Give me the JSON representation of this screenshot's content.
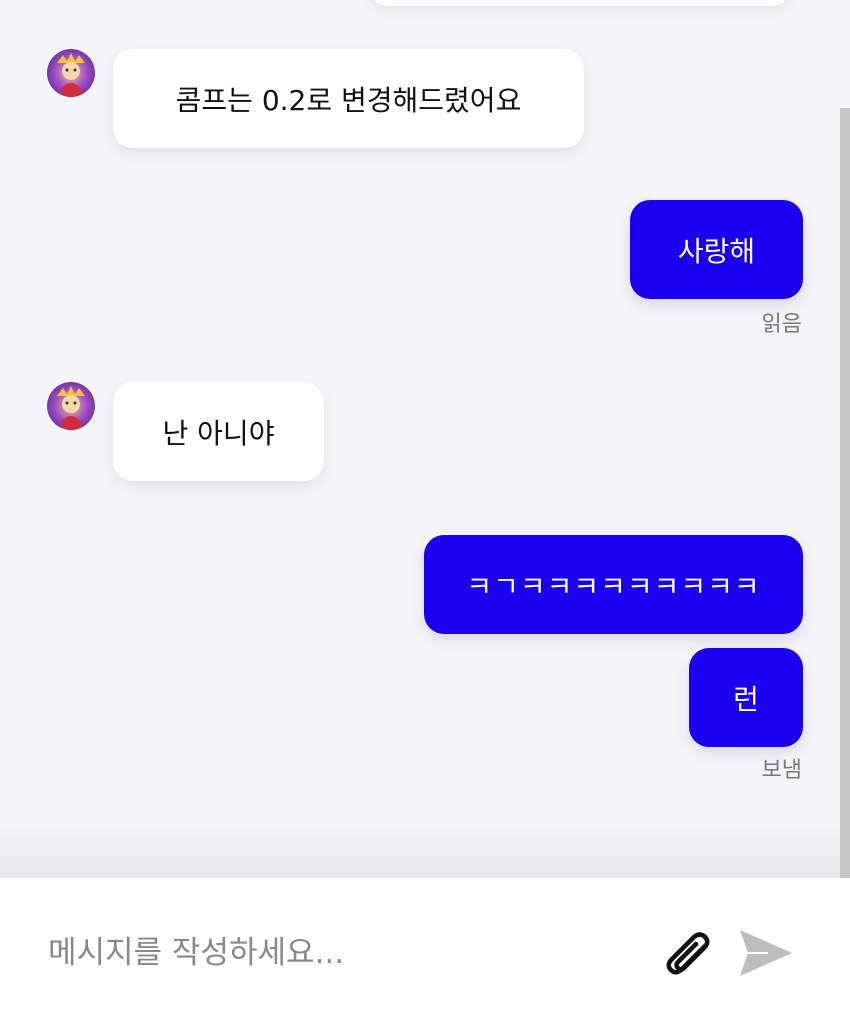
{
  "colors": {
    "background": "#f5f5f7",
    "incoming_bubble": "#ffffff",
    "outgoing_bubble": "#1a00ee",
    "status_text": "#777777",
    "send_icon": "#bdbdbd"
  },
  "messages": [
    {
      "direction": "incoming",
      "text": "콤프는 0.2로 변경해드렸어요",
      "avatar": "avatar-character-icon"
    },
    {
      "direction": "outgoing",
      "text": "사랑해",
      "status": "읽음"
    },
    {
      "direction": "incoming",
      "text": "난 아니야",
      "avatar": "avatar-character-icon"
    },
    {
      "direction": "outgoing",
      "text": "ㅋㄱㅋㅋㅋㅋㅋㅋㅋㅋㅋ"
    },
    {
      "direction": "outgoing",
      "text": "런",
      "status": "보냄"
    }
  ],
  "composer": {
    "placeholder": "메시지를 작성하세요...",
    "attach_icon": "paperclip-icon",
    "send_icon": "send-icon"
  }
}
